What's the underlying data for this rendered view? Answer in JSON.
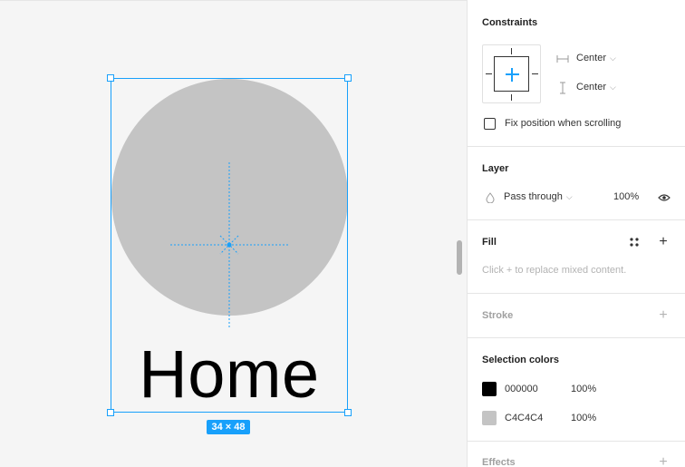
{
  "canvas": {
    "home_label": "Home",
    "size_badge": "34 × 48"
  },
  "panel": {
    "constraints": {
      "title": "Constraints",
      "horizontal": "Center",
      "vertical": "Center",
      "fix_position_label": "Fix position when scrolling",
      "fix_position_checked": false
    },
    "layer": {
      "title": "Layer",
      "blend_mode": "Pass through",
      "opacity": "100%"
    },
    "fill": {
      "title": "Fill",
      "hint": "Click + to replace mixed content."
    },
    "stroke": {
      "title": "Stroke"
    },
    "selection_colors": {
      "title": "Selection colors",
      "colors": [
        {
          "hex": "000000",
          "opacity": "100%",
          "swatch": "#000000"
        },
        {
          "hex": "C4C4C4",
          "opacity": "100%",
          "swatch": "#C4C4C4"
        }
      ]
    },
    "effects": {
      "title": "Effects"
    }
  },
  "colors": {
    "accent": "#18a0fb",
    "shape_fill": "#c4c4c4"
  }
}
